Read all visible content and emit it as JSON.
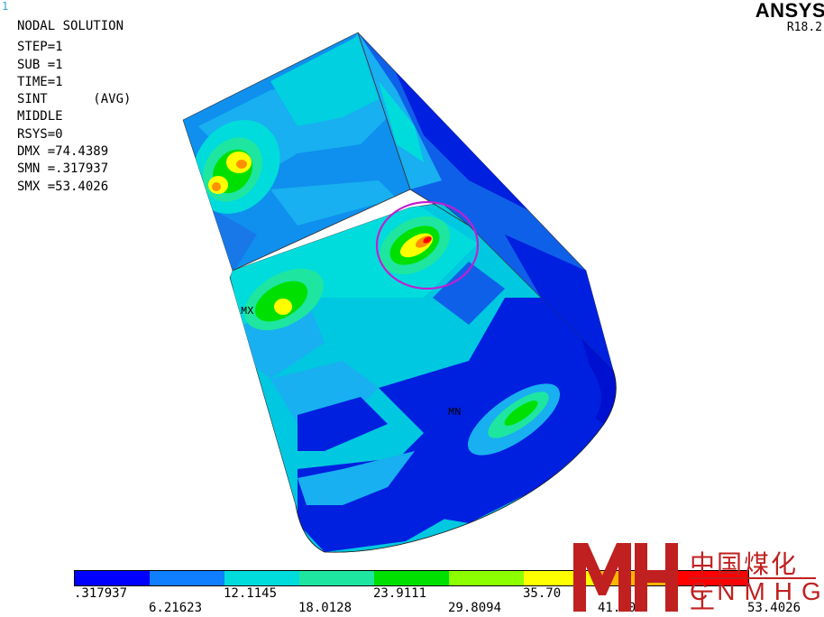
{
  "window_number": "1",
  "info": {
    "title": "NODAL SOLUTION",
    "step": "STEP=1",
    "sub": "SUB =1",
    "time": "TIME=1",
    "result": "SINT      (AVG)",
    "layer": "MIDDLE",
    "rsys": "RSYS=0",
    "dmx": "DMX =74.4389",
    "smn": "SMN =.317937",
    "smx": "SMX =53.4026"
  },
  "brand": {
    "name": "ANSYS",
    "version": "R18.2"
  },
  "markers": {
    "max": "MX",
    "min": "MN"
  },
  "legend": {
    "colors": [
      "#0000ff",
      "#0f7fff",
      "#00dcdc",
      "#1ee6a0",
      "#00e000",
      "#8cff00",
      "#ffff00",
      "#ffb400",
      "#ff0000"
    ],
    "labels_top": [
      ".317937",
      "12.1145",
      "23.9111",
      "35.70"
    ],
    "labels_bottom": [
      "6.21623",
      "18.0128",
      "29.8094",
      "41.506",
      "53.4026"
    ]
  },
  "watermark": {
    "cn": "中国煤化工",
    "en": "CNMHG"
  }
}
